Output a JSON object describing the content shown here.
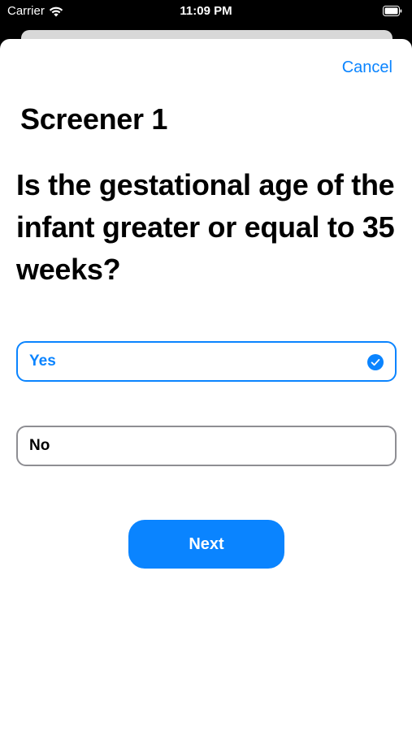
{
  "status_bar": {
    "carrier": "Carrier",
    "time": "11:09 PM",
    "icons": [
      "wifi-icon",
      "battery-icon"
    ]
  },
  "header": {
    "cancel_label": "Cancel"
  },
  "main": {
    "screener_title": "Screener 1",
    "question": "Is the gestational age of the infant greater or equal to 35 weeks?",
    "options": [
      {
        "label": "Yes",
        "selected": true
      },
      {
        "label": "No",
        "selected": false
      }
    ],
    "next_label": "Next"
  },
  "colors": {
    "accent": "#0a84ff",
    "unselected_border": "#8e8e93",
    "background": "#ffffff",
    "status_bar_background": "#000000"
  }
}
